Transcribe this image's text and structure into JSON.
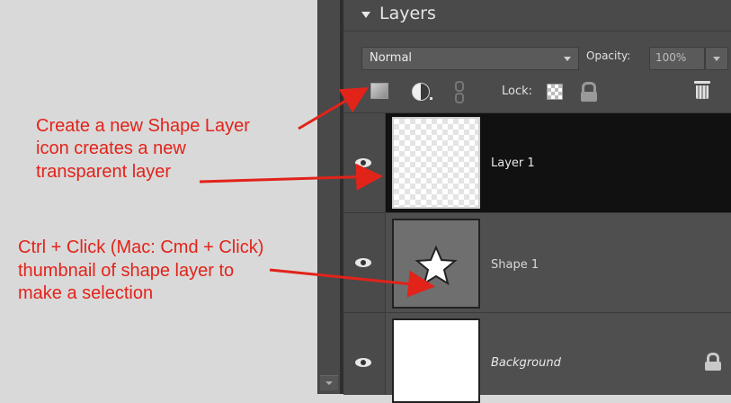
{
  "panel": {
    "title": "Layers",
    "blend_mode": "Normal",
    "opacity_label": "Opacity:",
    "opacity_value": "100%",
    "lock_label": "Lock:"
  },
  "layers": [
    {
      "name": "Layer 1",
      "selected": true,
      "thumbnail": "transparent-checker"
    },
    {
      "name": "Shape 1",
      "selected": false,
      "thumbnail": "star-shape"
    },
    {
      "name": "Background",
      "selected": false,
      "thumbnail": "white",
      "locked": true
    }
  ],
  "annotations": {
    "new_layer_note": [
      "Create a new Shape Layer",
      "icon creates a new",
      "transparent layer"
    ],
    "selection_note": [
      "Ctrl + Click (Mac: Cmd + Click)",
      "thumbnail of shape layer to",
      "make a selection"
    ]
  },
  "colors": {
    "annotation": "#e2231a",
    "panel_bg": "#4b4b4b",
    "selected_row": "#111111"
  },
  "icons": [
    "eye-icon",
    "new-layer-icon",
    "adjustment-layer-icon",
    "link-icon",
    "lock-transparent-icon",
    "lock-all-icon",
    "trash-icon",
    "star-icon",
    "lock-icon"
  ]
}
